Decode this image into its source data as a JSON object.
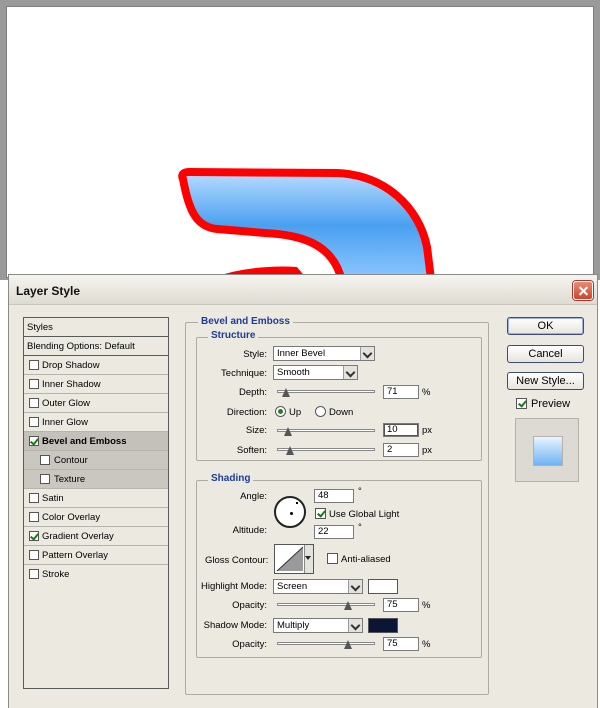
{
  "dialog": {
    "title": "Layer Style",
    "buttons": {
      "ok": "OK",
      "cancel": "Cancel",
      "new_style": "New Style..."
    },
    "preview": {
      "label": "Preview",
      "checked": true
    }
  },
  "styles_list": {
    "header": "Styles",
    "items": [
      {
        "label": "Blending Options: Default",
        "kind": "plain"
      },
      {
        "label": "Drop Shadow",
        "checked": false
      },
      {
        "label": "Inner Shadow",
        "checked": false
      },
      {
        "label": "Outer Glow",
        "checked": false
      },
      {
        "label": "Inner Glow",
        "checked": false
      },
      {
        "label": "Bevel and Emboss",
        "checked": true,
        "selected": true
      },
      {
        "label": "Contour",
        "checked": false,
        "sub": true
      },
      {
        "label": "Texture",
        "checked": false,
        "sub": true
      },
      {
        "label": "Satin",
        "checked": false
      },
      {
        "label": "Color Overlay",
        "checked": false
      },
      {
        "label": "Gradient Overlay",
        "checked": true
      },
      {
        "label": "Pattern Overlay",
        "checked": false
      },
      {
        "label": "Stroke",
        "checked": false
      }
    ]
  },
  "bevel": {
    "section_title": "Bevel and Emboss",
    "structure": {
      "title": "Structure",
      "style_label": "Style:",
      "style_value": "Inner Bevel",
      "technique_label": "Technique:",
      "technique_value": "Smooth",
      "depth_label": "Depth:",
      "depth_value": "71",
      "depth_unit": "%",
      "depth_level": 0.06,
      "direction_label": "Direction:",
      "direction_up": "Up",
      "direction_down": "Down",
      "direction_selected": "Up",
      "size_label": "Size:",
      "size_value": "10",
      "size_unit": "px",
      "size_level": 0.08,
      "soften_label": "Soften:",
      "soften_value": "2",
      "soften_unit": "px",
      "soften_level": 0.1
    },
    "shading": {
      "title": "Shading",
      "angle_label": "Angle:",
      "angle_value": "48",
      "angle_unit": "°",
      "global_light_label": "Use Global Light",
      "global_light": true,
      "altitude_label": "Altitude:",
      "altitude_value": "22",
      "altitude_unit": "°",
      "gloss_label": "Gloss Contour:",
      "anti_aliased_label": "Anti-aliased",
      "anti_aliased": false,
      "highlight_label": "Highlight Mode:",
      "highlight_value": "Screen",
      "highlight_color": "#ffffff",
      "highlight_opacity_label": "Opacity:",
      "highlight_opacity": "75",
      "highlight_opacity_unit": "%",
      "shadow_label": "Shadow Mode:",
      "shadow_value": "Multiply",
      "shadow_color": "#0b1636",
      "shadow_opacity_label": "Opacity:",
      "shadow_opacity": "75",
      "shadow_opacity_unit": "%"
    }
  },
  "colors": {
    "stroke_red": "#ff0000",
    "fill_blue": "#5aa9f5",
    "title_blue": "#1c3d9a"
  }
}
